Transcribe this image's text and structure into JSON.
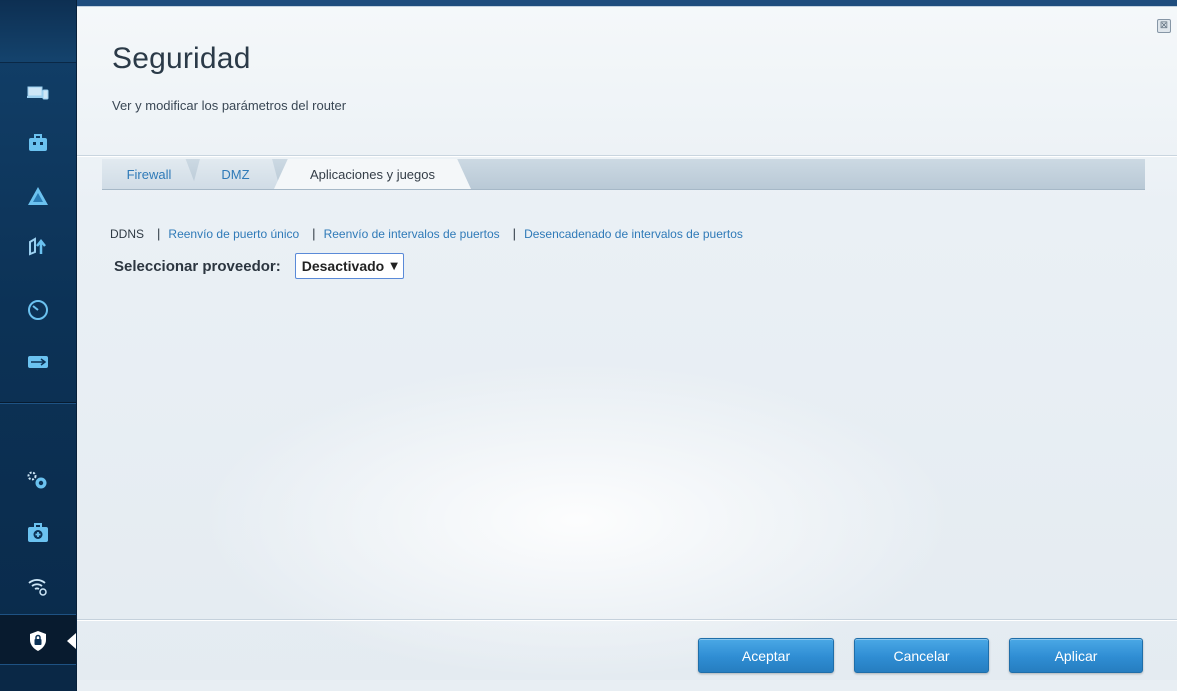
{
  "sidebar": {
    "items": [
      {
        "icon": "devices-icon"
      },
      {
        "icon": "toolbox-icon"
      },
      {
        "icon": "network-map-icon"
      },
      {
        "icon": "upload-icon"
      },
      {
        "icon": "speed-gauge-icon"
      },
      {
        "icon": "usb-icon"
      },
      {
        "icon": "gear-settings-icon"
      },
      {
        "icon": "first-aid-icon"
      },
      {
        "icon": "wifi-settings-icon"
      },
      {
        "icon": "security-shield-icon"
      }
    ],
    "active_item": "security-shield-icon",
    "colors": {
      "background": "#0c3256",
      "accent": "#3fa9e6"
    }
  },
  "header": {
    "title": "Seguridad",
    "subtitle": "Ver y modificar los parámetros del router"
  },
  "close_icon": "⊠",
  "tabs": [
    {
      "label": "Firewall",
      "active": false
    },
    {
      "label": "DMZ",
      "active": false
    },
    {
      "label": "Aplicaciones y juegos",
      "active": true
    }
  ],
  "sublinks": {
    "current": "DDNS",
    "links": [
      "Reenvío de puerto único",
      "Reenvío de intervalos de puertos",
      "Desencadenado de intervalos de puertos"
    ],
    "separator": "|"
  },
  "provider": {
    "label": "Seleccionar proveedor:",
    "selected": "Desactivado",
    "caret": "▼"
  },
  "buttons": {
    "accept": "Aceptar",
    "cancel": "Cancelar",
    "apply": "Aplicar"
  },
  "colors": {
    "link": "#2f7ab8",
    "button": "#2f8dd3",
    "title": "#2b3a48"
  }
}
